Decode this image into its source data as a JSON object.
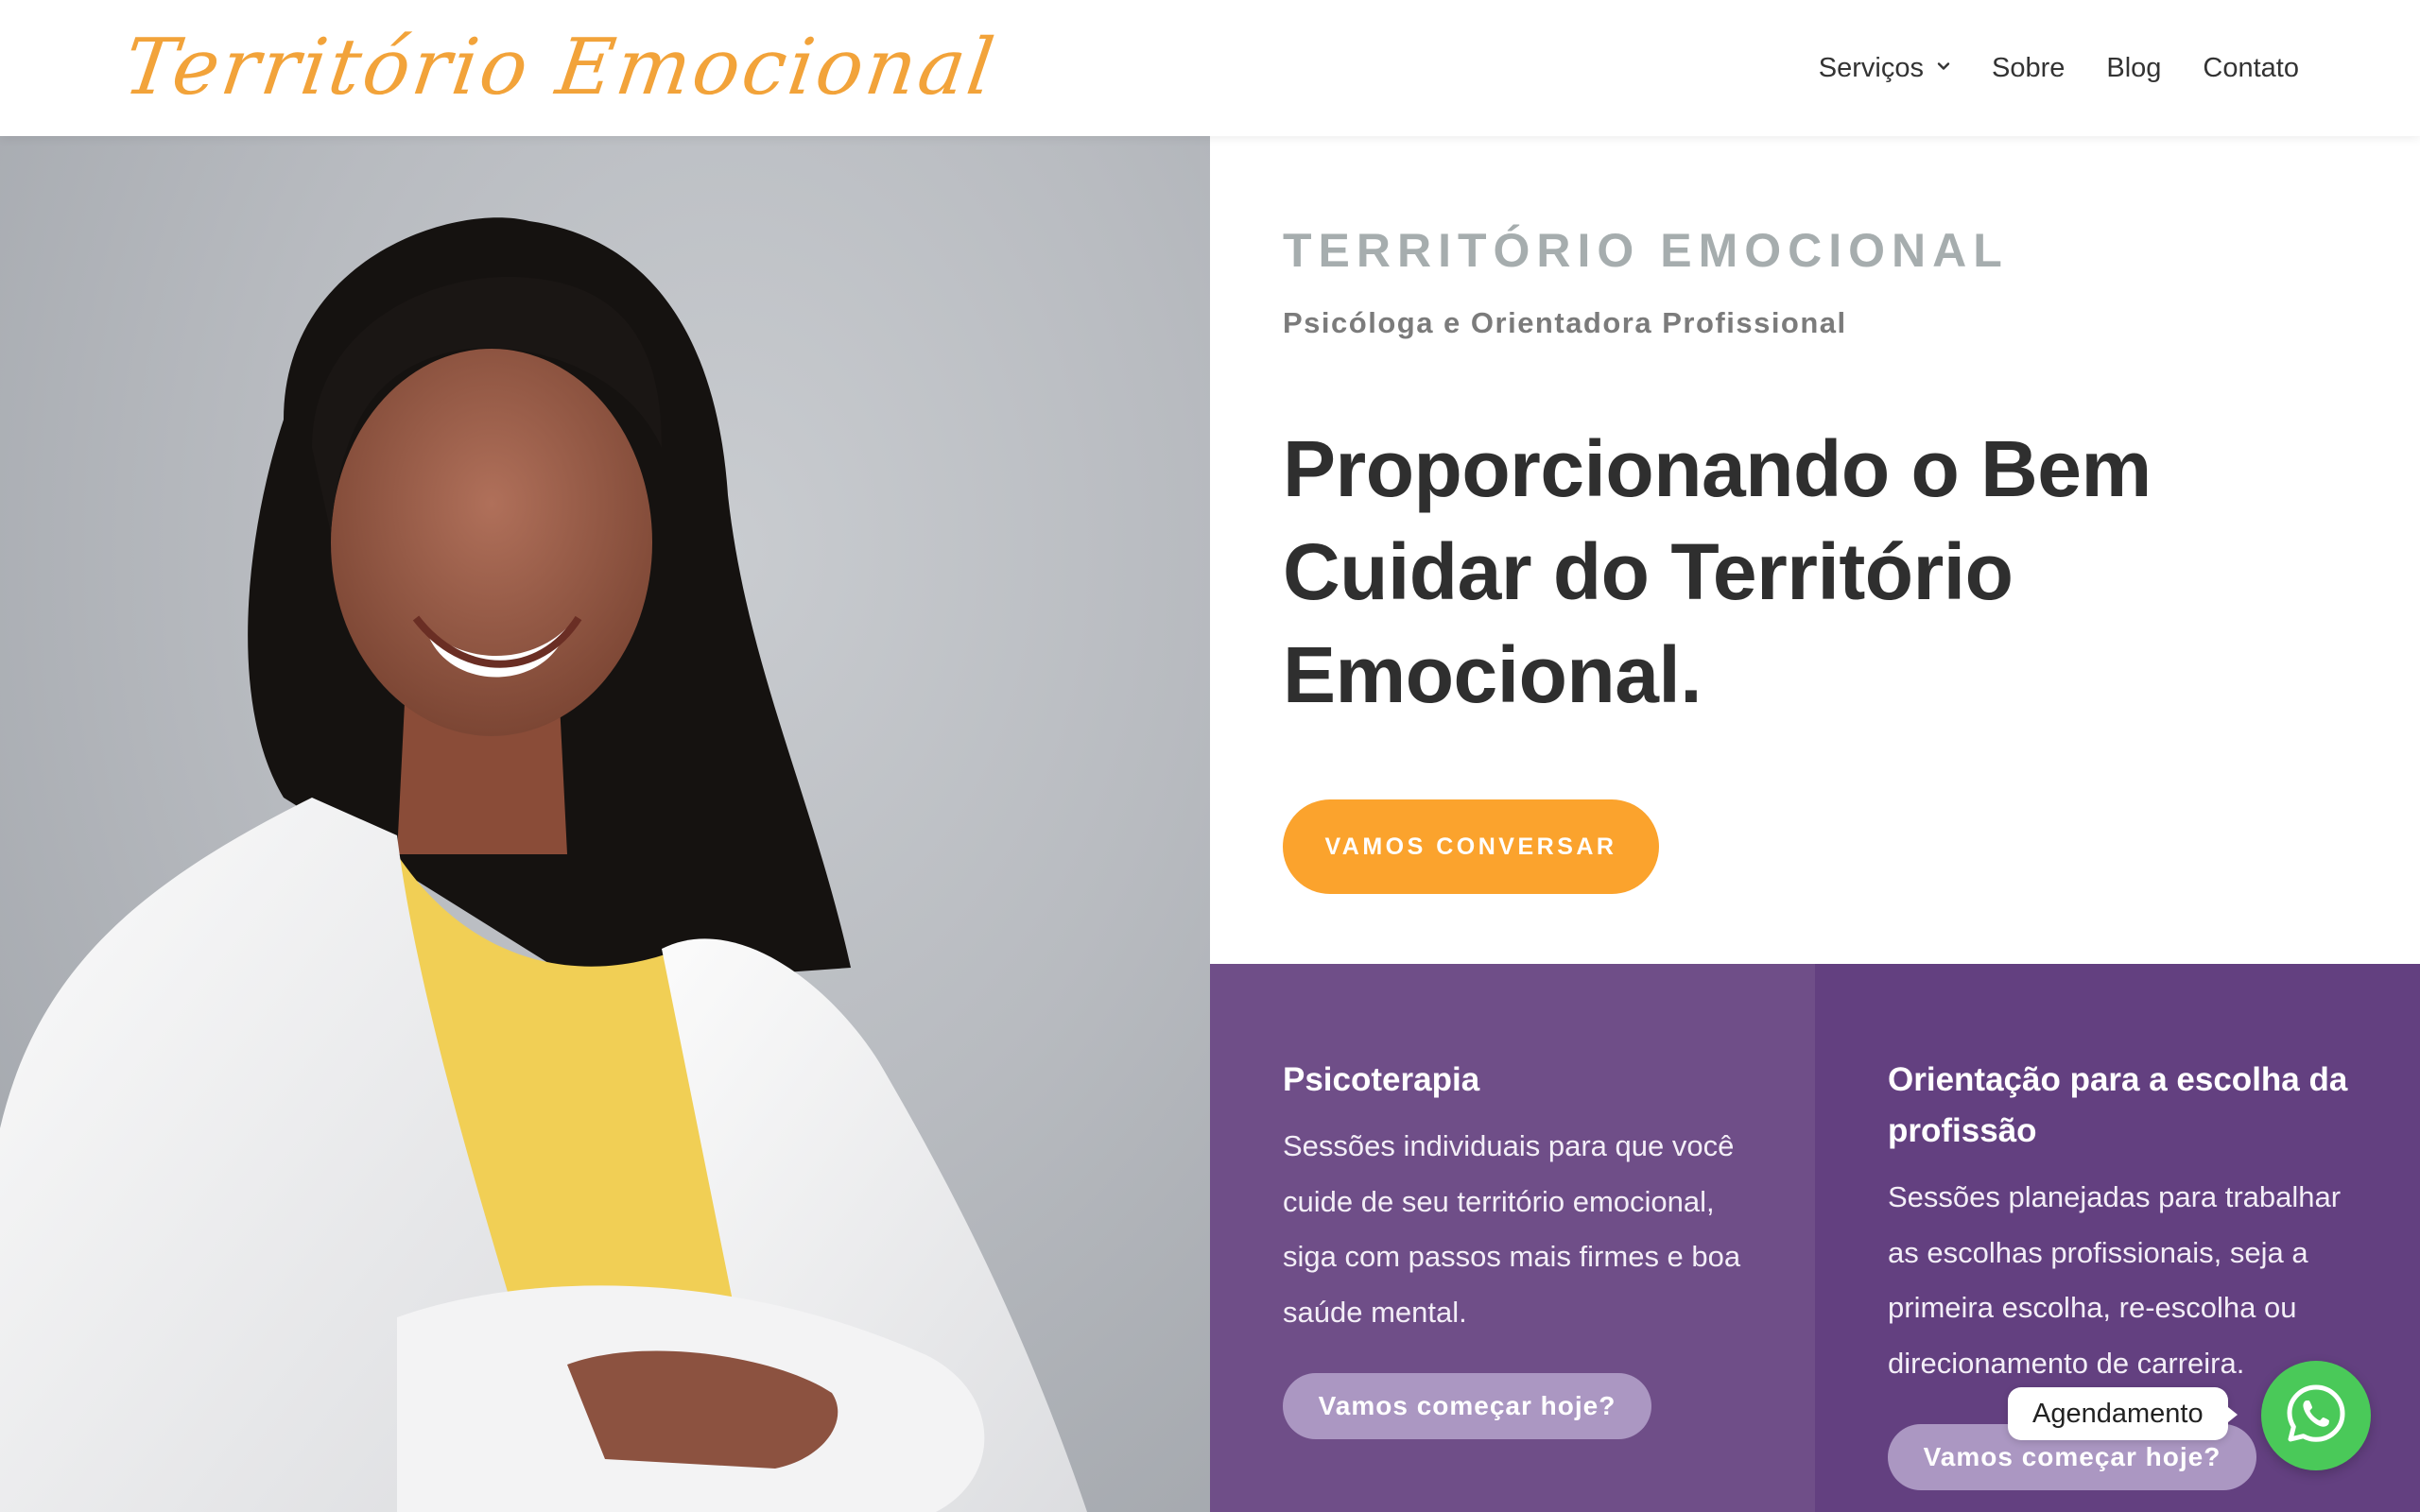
{
  "brand": {
    "logo_text": "Território Emocional",
    "accent_color": "#fba32d",
    "logo_color": "#f2a33a"
  },
  "nav": {
    "items": [
      {
        "label": "Serviços",
        "has_dropdown": true
      },
      {
        "label": "Sobre"
      },
      {
        "label": "Blog"
      },
      {
        "label": "Contato"
      }
    ]
  },
  "hero": {
    "eyebrow": "TERRITÓRIO EMOCIONAL",
    "subtitle": "Psicóloga e Orientadora Profissional",
    "headline": "Proporcionando o Bem Cuidar do Território Emocional.",
    "cta_label": "VAMOS CONVERSAR"
  },
  "services": [
    {
      "title": "Psicoterapia",
      "description": "Sessões individuais para que você cuide de seu território emocional, siga com passos mais firmes e boa saúde mental.",
      "button_label": "Vamos começar hoje?",
      "bg_color": "#6f4e88"
    },
    {
      "title": "Orientação para a escolha da profissão",
      "description": "Sessões planejadas para trabalhar as escolhas profissionais, seja a primeira escolha, re-escolha ou direcionamento de carreira.",
      "button_label": "Vamos começar hoje?",
      "bg_color": "#634080"
    }
  ],
  "whatsapp": {
    "label": "Agendamento",
    "icon": "whatsapp-icon",
    "color": "#4ac959"
  },
  "photo": {
    "icon": "portrait-photo"
  }
}
